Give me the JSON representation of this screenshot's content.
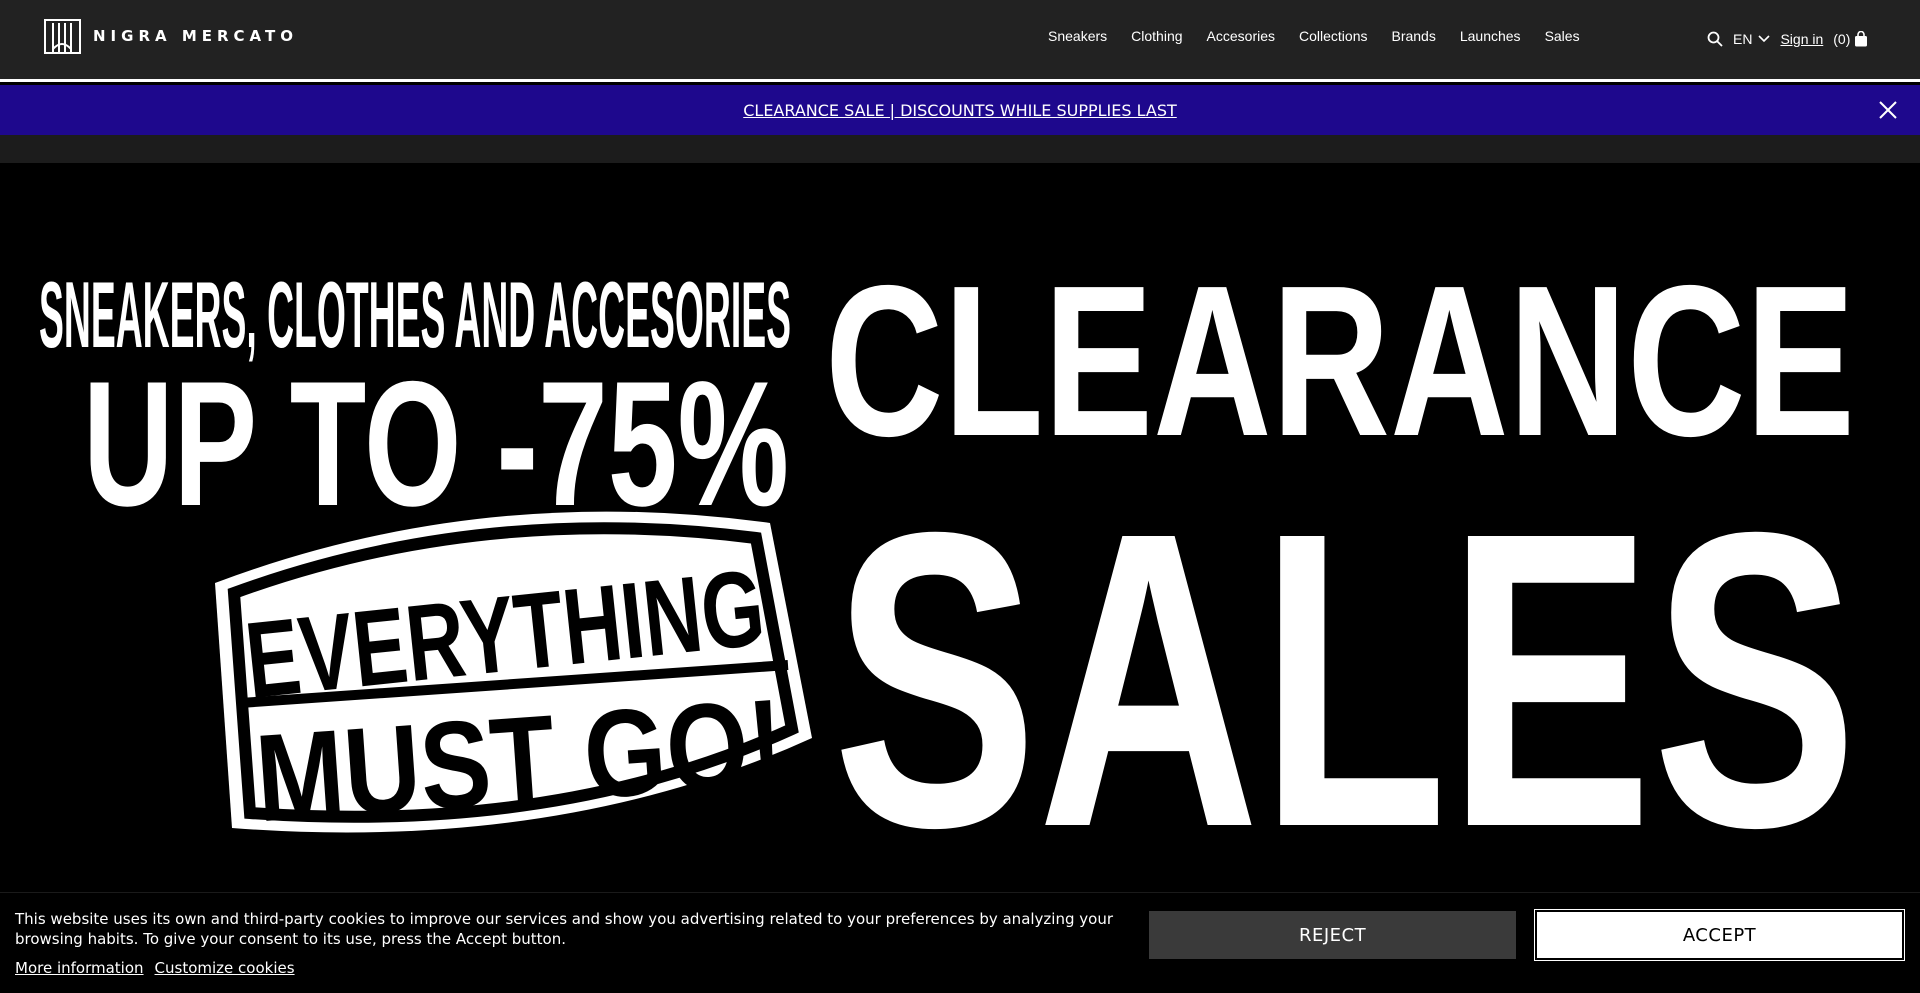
{
  "header": {
    "logo_text": "NIGRA MERCATO",
    "nav": [
      "Sneakers",
      "Clothing",
      "Accesories",
      "Collections",
      "Brands",
      "Launches",
      "Sales"
    ],
    "lang": "EN",
    "signin": "Sign in",
    "cart_count": "(0)"
  },
  "promo": {
    "text": "CLEARANCE SALE | DISCOUNTS WHILE SUPPLIES LAST"
  },
  "hero": {
    "line1": "SNEAKERS, CLOTHES AND ACCESORIES",
    "line2": "UP TO -75%",
    "badge_line1": "EVERYTHING",
    "badge_line2": "MUST GO!",
    "big1": "CLEARANCE",
    "big2": "SALES"
  },
  "cookie": {
    "text": "This website uses its own and third-party cookies to improve our services and show you advertising related to your preferences by analyzing your browsing habits. To give your consent to its use, press the Accept button.",
    "more_info": "More information",
    "customize": "Customize cookies",
    "reject": "REJECT",
    "accept": "ACCEPT"
  },
  "colors": {
    "header_bg": "#222222",
    "promo_bg": "#1e088d",
    "hero_bg": "#000000"
  }
}
